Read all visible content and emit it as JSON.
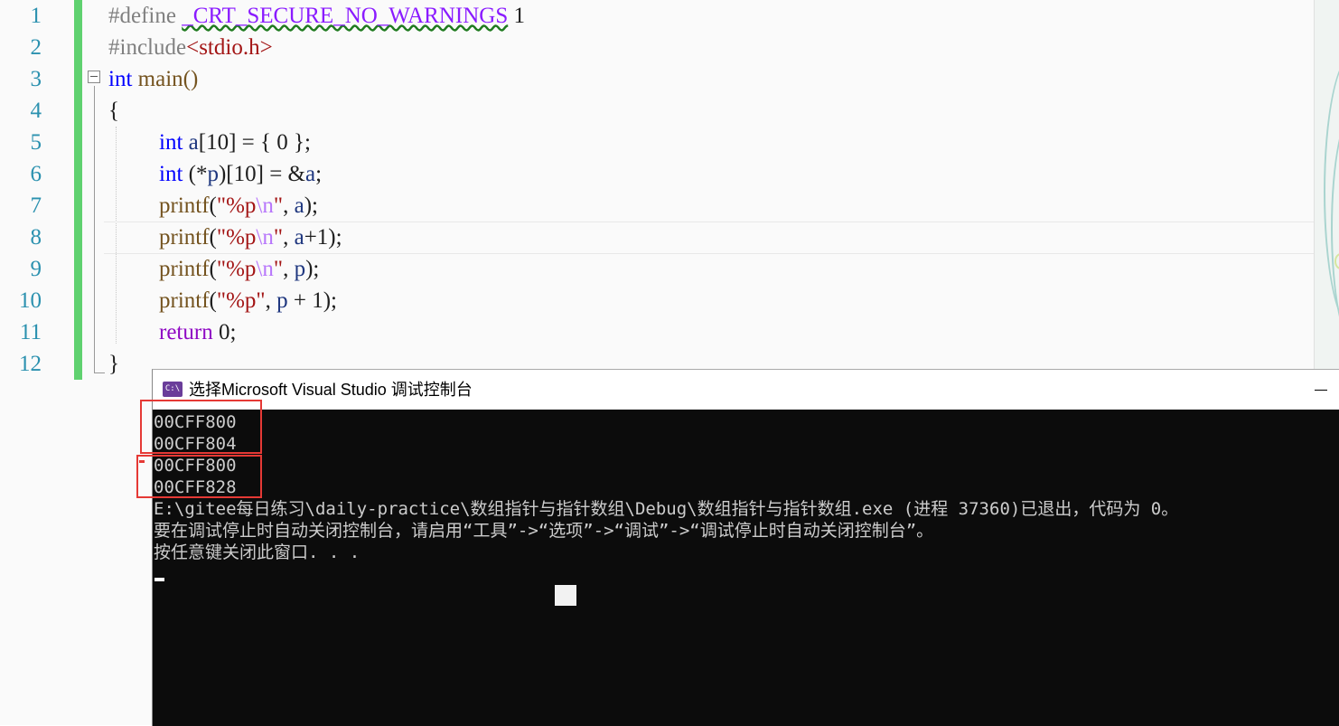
{
  "editor": {
    "line_numbers": [
      "1",
      "2",
      "3",
      "4",
      "5",
      "6",
      "7",
      "8",
      "9",
      "10",
      "11",
      "12"
    ],
    "lines": {
      "l1_directive": "#define",
      "l1_macro": "_CRT_SECURE_NO_WARNINGS",
      "l1_value": "1",
      "l2_directive": "#include",
      "l2_header": "<stdio.h>",
      "l3_kw": "int",
      "l3_rest": " main()",
      "l4": "{",
      "l5_kw": "int",
      "l5_var": "a",
      "l5_rest": "[10] = { 0 };",
      "l6_kw": "int",
      "l6_a": " (*",
      "l6_p": "p",
      "l6_b": ")[10] = &",
      "l6_a2": "a",
      "l6_end": ";",
      "l7_fn": "printf",
      "l7_open": "(",
      "l7_str": "\"%p",
      "l7_esc": "\\n",
      "l7_strend": "\"",
      "l7_sep": ", ",
      "l7_var": "a",
      "l7_end": ");",
      "l8_fn": "printf",
      "l8_open": "(",
      "l8_str": "\"%p",
      "l8_esc": "\\n",
      "l8_strend": "\"",
      "l8_sep": ", ",
      "l8_var": "a",
      "l8_end": "+1);",
      "l9_fn": "printf",
      "l9_open": "(",
      "l9_str": "\"%p",
      "l9_esc": "\\n",
      "l9_strend": "\"",
      "l9_sep": ", ",
      "l9_var": "p",
      "l9_end": ");",
      "l10_fn": "printf",
      "l10_open": "(",
      "l10_str": "\"%p\"",
      "l10_sep": ", ",
      "l10_var": "p",
      "l10_end": " + 1);",
      "l11_kw": "return",
      "l11_rest": " 0;",
      "l12": "}"
    }
  },
  "console": {
    "title": "选择Microsoft Visual Studio 调试控制台",
    "icon_text": "C:\\",
    "output": [
      "00CFF800",
      "00CFF804",
      "00CFF800",
      "00CFF828",
      "E:\\gitee每日练习\\daily-practice\\数组指针与指针数组\\Debug\\数组指针与指针数组.exe (进程 37360)已退出，代码为 0。",
      "要在调试停止时自动关闭控制台，请启用“工具”->“选项”->“调试”->“调试停止时自动关闭控制台”。",
      "按任意键关闭此窗口. . ."
    ]
  },
  "colors": {
    "line_number": "#2b91af",
    "keyword": "#0000ff",
    "string": "#a31515",
    "highlight_box": "#e53935",
    "console_bg": "#0c0c0c"
  }
}
